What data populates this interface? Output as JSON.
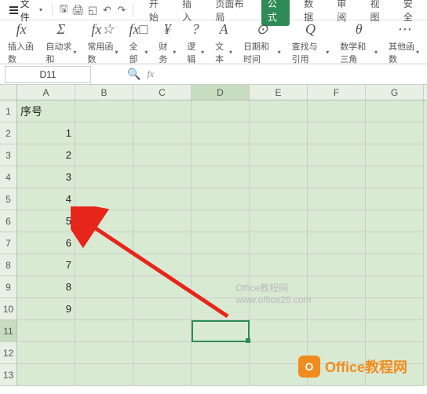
{
  "titlebar": {
    "file_menu": "文件",
    "tabs": [
      "开始",
      "插入",
      "页面布局",
      "公式",
      "数据",
      "审阅",
      "视图",
      "安全"
    ],
    "active_tab_index": 3
  },
  "ribbon": {
    "groups": [
      {
        "icon": "fx",
        "label": "插入函数"
      },
      {
        "icon": "Σ",
        "label": "自动求和",
        "dd": true
      },
      {
        "icon": "fx☆",
        "label": "常用函数",
        "dd": true
      },
      {
        "icon": "fx□",
        "label": "全部",
        "dd": true
      },
      {
        "icon": "¥",
        "label": "财务",
        "dd": true
      },
      {
        "icon": "?",
        "label": "逻辑",
        "dd": true
      },
      {
        "icon": "A",
        "label": "文本",
        "dd": true
      },
      {
        "icon": "⊙",
        "label": "日期和时间",
        "dd": true
      },
      {
        "icon": "Q",
        "label": "查找与引用",
        "dd": true
      },
      {
        "icon": "θ",
        "label": "数学和三角",
        "dd": true
      },
      {
        "icon": "⋯",
        "label": "其他函数",
        "dd": true
      }
    ]
  },
  "formula_bar": {
    "name_box": "D11",
    "fx_label": "fx"
  },
  "grid": {
    "columns": [
      "A",
      "B",
      "C",
      "D",
      "E",
      "F",
      "G"
    ],
    "selected_col_index": 3,
    "selected_row_index": 10,
    "row_count": 13,
    "cells": {
      "A1": {
        "value": "序号",
        "type": "lbl"
      },
      "A2": {
        "value": "1",
        "type": "num"
      },
      "A3": {
        "value": "2",
        "type": "num"
      },
      "A4": {
        "value": "3",
        "type": "num"
      },
      "A5": {
        "value": "4",
        "type": "num"
      },
      "A6": {
        "value": "5",
        "type": "num"
      },
      "A7": {
        "value": "6",
        "type": "num"
      },
      "A8": {
        "value": "7",
        "type": "num"
      },
      "A9": {
        "value": "8",
        "type": "num"
      },
      "A10": {
        "value": "9",
        "type": "num"
      }
    }
  },
  "watermark": {
    "line1": "Office教程网",
    "line2": "www.office26.com"
  },
  "logo": {
    "text": "Office教程网"
  }
}
